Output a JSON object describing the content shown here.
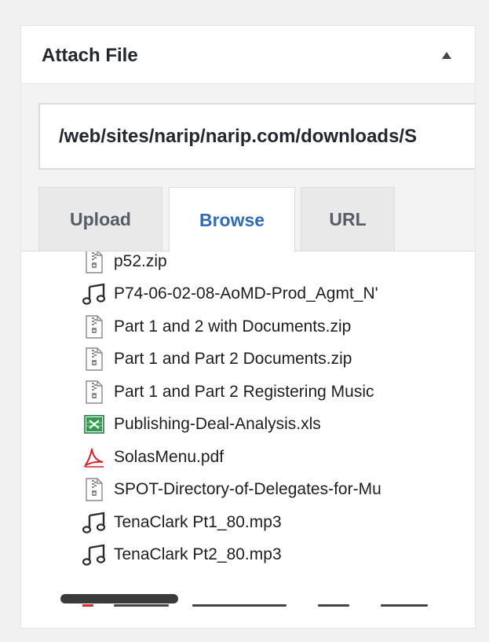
{
  "panel": {
    "title": "Attach File"
  },
  "path_input": {
    "value": "/web/sites/narip/narip.com/downloads/S"
  },
  "tabs": [
    {
      "label": "Upload",
      "active": false
    },
    {
      "label": "Browse",
      "active": true
    },
    {
      "label": "URL",
      "active": false
    }
  ],
  "files": [
    {
      "name": "p52.zip",
      "icon": "zip-file-icon"
    },
    {
      "name": "P74-06-02-08-AoMD-Prod_Agmt_N'",
      "icon": "audio-file-icon"
    },
    {
      "name": "Part 1 and 2 with Documents.zip",
      "icon": "zip-file-icon"
    },
    {
      "name": "Part 1 and Part 2 Documents.zip",
      "icon": "zip-file-icon"
    },
    {
      "name": "Part 1 and Part 2 Registering Music",
      "icon": "zip-file-icon"
    },
    {
      "name": "Publishing-Deal-Analysis.xls",
      "icon": "spreadsheet-file-icon"
    },
    {
      "name": "SolasMenu.pdf",
      "icon": "pdf-file-icon"
    },
    {
      "name": "SPOT-Directory-of-Delegates-for-Mu",
      "icon": "zip-file-icon"
    },
    {
      "name": "TenaClark Pt1_80.mp3",
      "icon": "audio-file-icon"
    },
    {
      "name": "TenaClark Pt2_80.mp3",
      "icon": "audio-file-icon"
    }
  ],
  "colors": {
    "accent": "#2f6db7",
    "excel_green": "#1e7a3c",
    "pdf_red": "#d4232b"
  }
}
